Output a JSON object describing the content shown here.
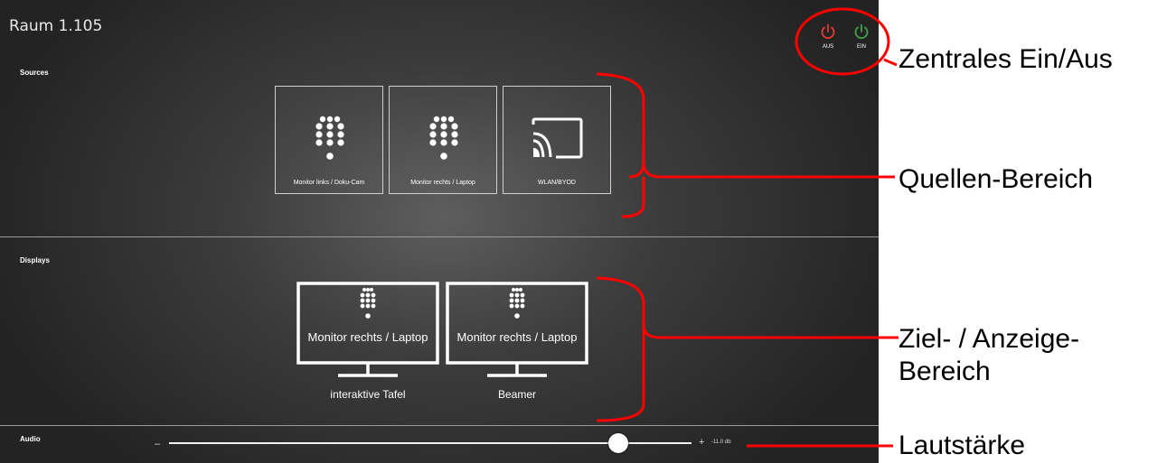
{
  "room_title": "Raum 1.105",
  "power": {
    "off_label": "AUS",
    "on_label": "EIN",
    "off_color": "#e53935",
    "on_color": "#43a047"
  },
  "sections": {
    "sources": "Sources",
    "displays": "Displays",
    "audio": "Audio"
  },
  "sources": [
    {
      "label": "Monitor links / Doku-Cam",
      "icon": "keypad-icon"
    },
    {
      "label": "Monitor rechts / Laptop",
      "icon": "keypad-icon"
    },
    {
      "label": "WLAN/BYOD",
      "icon": "cast-icon"
    }
  ],
  "displays": [
    {
      "source": "Monitor rechts / Laptop",
      "name": "interaktive Tafel",
      "icon": "monitor-icon"
    },
    {
      "source": "Monitor rechts / Laptop",
      "name": "Beamer",
      "icon": "monitor-icon"
    }
  ],
  "audio": {
    "minus": "–",
    "plus": "+",
    "value_label": "-11.0 db",
    "level_fraction": 0.86
  },
  "annotations": {
    "power": "Zentrales Ein/Aus",
    "sources": "Quellen-Bereich",
    "displays": "Ziel- / Anzeige-Bereich",
    "volume": "Lautstärke",
    "color": "#ff0000"
  }
}
